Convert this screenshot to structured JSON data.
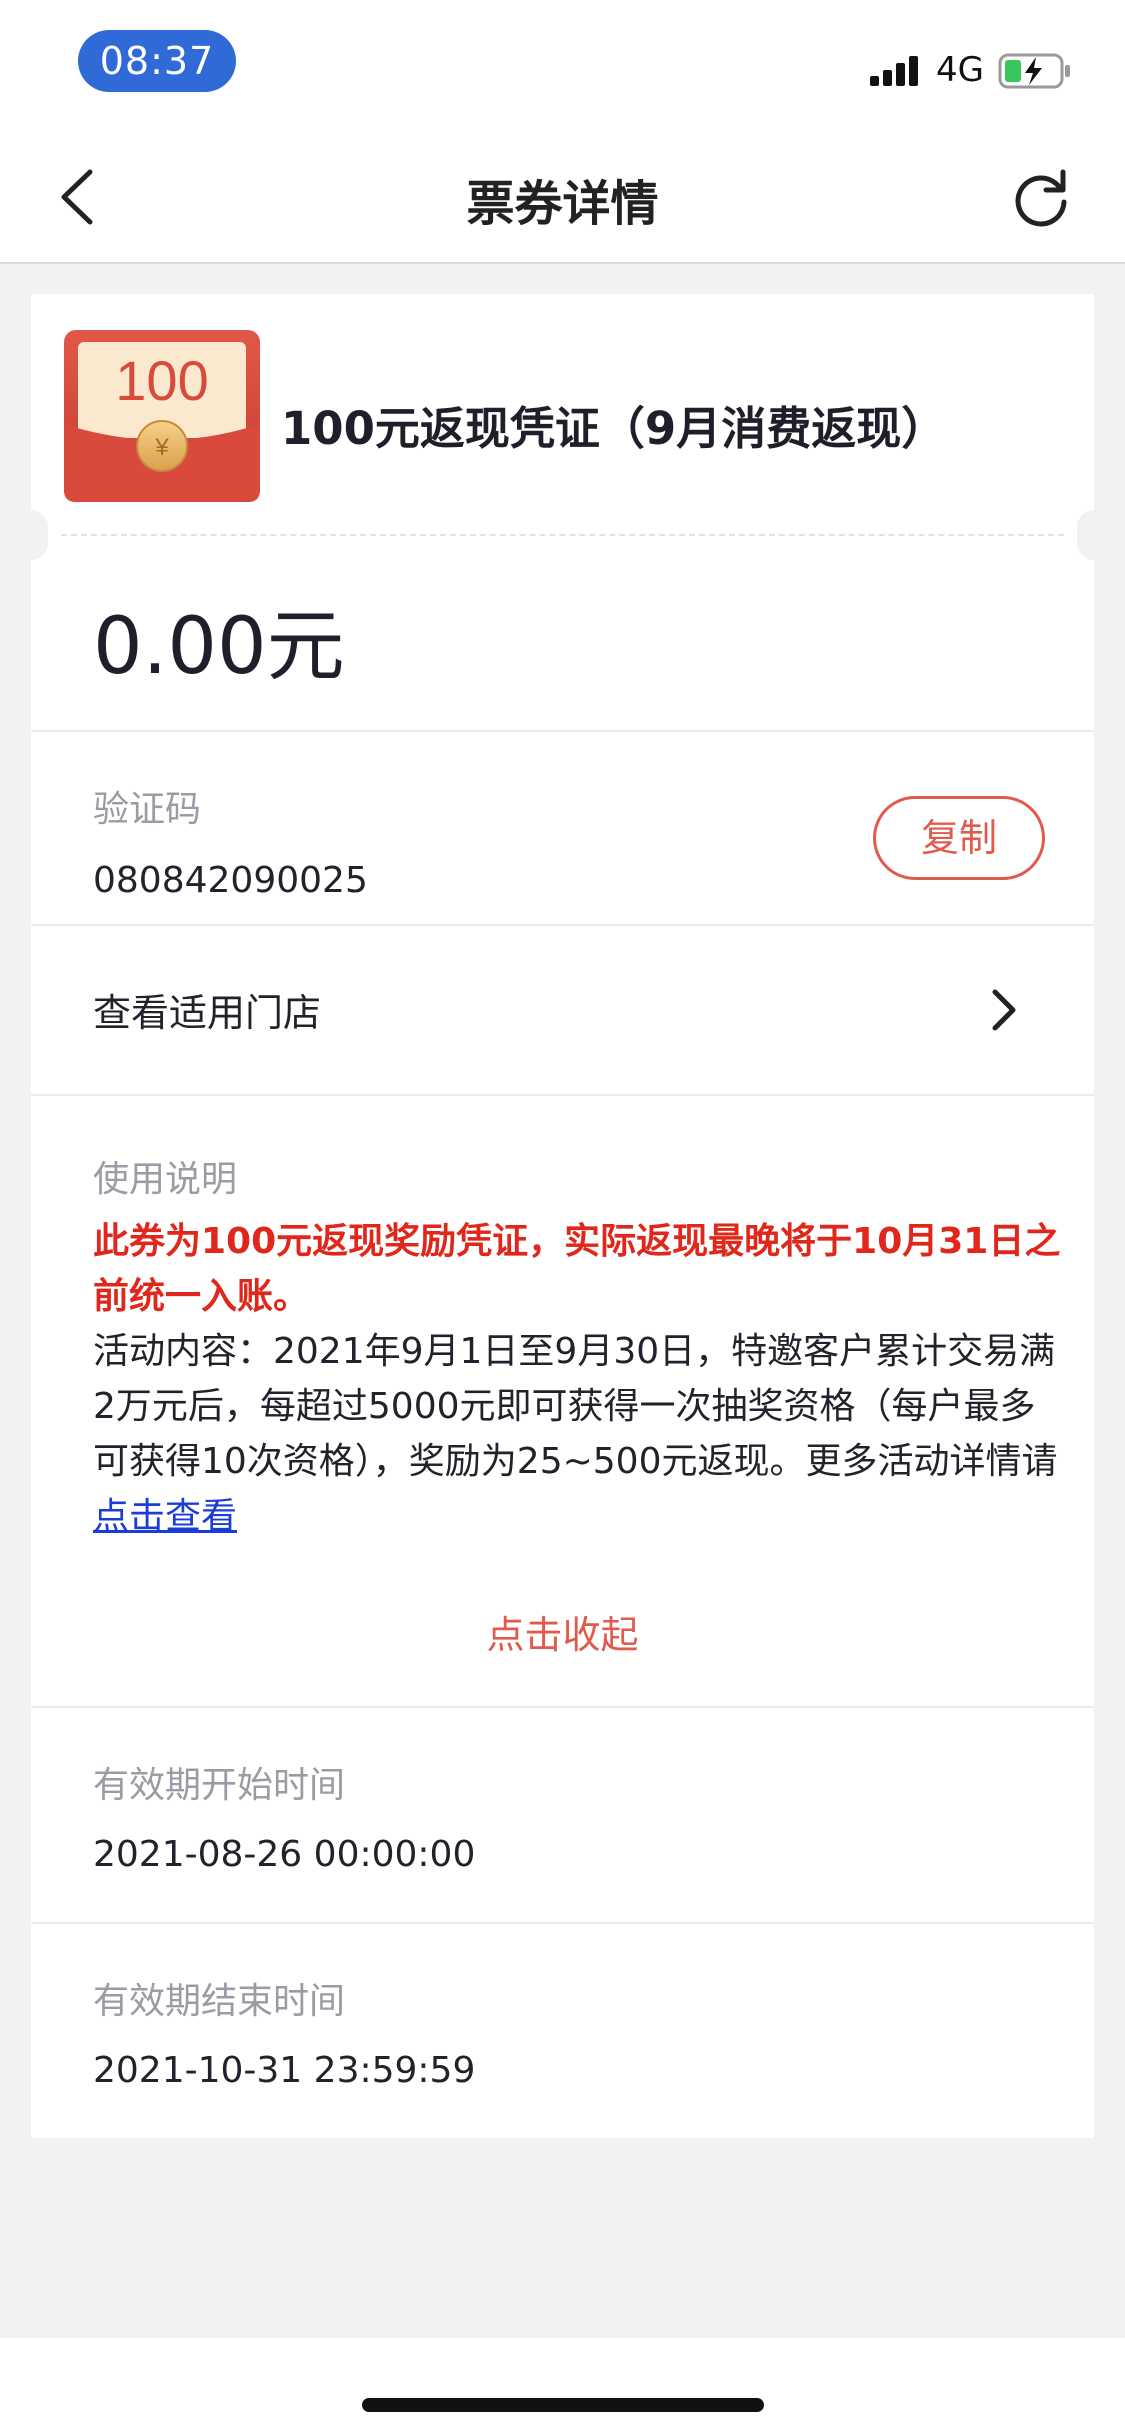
{
  "status_bar": {
    "time": "08:37",
    "network": "4G",
    "icons": [
      "signal-icon",
      "battery-charging-icon"
    ]
  },
  "nav": {
    "title": "票券详情",
    "icons": [
      "back-arrow-icon",
      "refresh-icon"
    ]
  },
  "coupon": {
    "icon_amount": "100",
    "icon_currency": "¥",
    "title": "100元返现凭证（9月消费返现）",
    "amount": "0.00元"
  },
  "verification": {
    "label": "验证码",
    "code": "080842090025",
    "copy_label": "复制"
  },
  "stores": {
    "label": "查看适用门店"
  },
  "instructions": {
    "label": "使用说明",
    "highlight": "此券为100元返现奖励凭证，实际返现最晚将于10月31日之前统一入账。",
    "body": "活动内容：2021年9月1日至9月30日，特邀客户累计交易满2万元后，每超过5000元即可获得一次抽奖资格（每户最多可获得10次资格），奖励为25~500元返现。更多活动详情请",
    "link": "点击查看",
    "collapse": "点击收起"
  },
  "validity": {
    "start_label": "有效期开始时间",
    "start_value": "2021-08-26 00:00:00",
    "end_label": "有效期结束时间",
    "end_value": "2021-10-31 23:59:59"
  },
  "colors": {
    "accent_red": "#e05a4e",
    "highlight_red": "#e0271b",
    "link_blue": "#1a3cd8",
    "time_pill_blue": "#2f6ad6"
  }
}
